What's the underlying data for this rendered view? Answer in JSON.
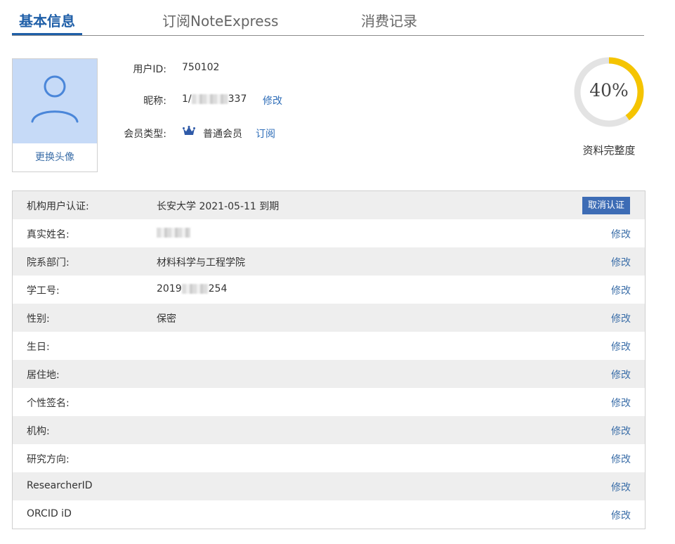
{
  "tabs": [
    {
      "label": "基本信息"
    },
    {
      "label": "订阅NoteExpress"
    },
    {
      "label": "消费记录"
    }
  ],
  "avatar": {
    "change_label": "更换头像",
    "icon": "user-icon"
  },
  "profile": {
    "user_id_label": "用户ID:",
    "user_id_value": "750102",
    "nickname_label": "昵称:",
    "nickname_prefix": "1/",
    "nickname_suffix": "337",
    "nickname_edit": "修改",
    "member_type_label": "会员类型:",
    "member_type_value": "普通会员",
    "member_icon": "crown-icon",
    "subscribe_label": "订阅"
  },
  "completeness": {
    "value": 40,
    "text": "40%",
    "caption": "资料完整度",
    "color": "#f5c400"
  },
  "details": {
    "rows": [
      {
        "label": "机构用户认证:",
        "value": "长安大学 2021-05-11 到期",
        "action": "取消认证"
      },
      {
        "label": "真实姓名:",
        "value": "",
        "action": "修改"
      },
      {
        "label": "院系部门:",
        "value": "材料科学与工程学院",
        "action": "修改"
      },
      {
        "label": "学工号:",
        "value_prefix": "2019",
        "value_suffix": "254",
        "action": "修改"
      },
      {
        "label": "性别:",
        "value": "保密",
        "action": "修改"
      },
      {
        "label": "生日:",
        "value": "",
        "action": "修改"
      },
      {
        "label": "居住地:",
        "value": "",
        "action": "修改"
      },
      {
        "label": "个性签名:",
        "value": "",
        "action": "修改"
      },
      {
        "label": "机构:",
        "value": "",
        "action": "修改"
      },
      {
        "label": "研究方向:",
        "value": "",
        "action": "修改"
      },
      {
        "label": "ResearcherID",
        "value": "",
        "action": "修改"
      },
      {
        "label": "ORCID iD",
        "value": "",
        "action": "修改"
      }
    ]
  },
  "colors": {
    "accent": "#1f5fa8",
    "button": "#3d6cb5",
    "row_alt": "#eeeeee",
    "avatar_bg": "#c6daf7"
  }
}
